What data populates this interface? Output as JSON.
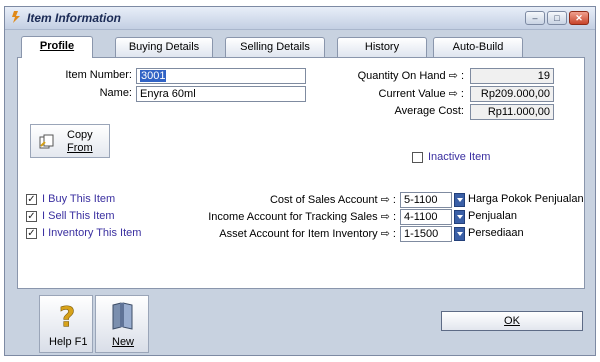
{
  "window": {
    "title": "Item Information",
    "buttons": [
      "minimize",
      "maximize",
      "close"
    ]
  },
  "tabs": [
    {
      "label": "Profile",
      "active": true
    },
    {
      "label": "Buying Details",
      "active": false
    },
    {
      "label": "Selling Details",
      "active": false
    },
    {
      "label": "History",
      "active": false
    },
    {
      "label": "Auto-Build",
      "active": false
    }
  ],
  "profile": {
    "item_number_label": "Item Number:",
    "item_number_value": "3001",
    "name_label": "Name:",
    "name_value": "Enyra 60ml",
    "qty_label": "Quantity On Hand ⇨ :",
    "qty_value": "19",
    "current_value_label": "Current Value ⇨ :",
    "current_value": "Rp209.000,00",
    "avg_cost_label": "Average Cost:",
    "avg_cost_value": "Rp11.000,00",
    "copy_from_label_1": "Copy",
    "copy_from_label_2": "From",
    "inactive_label": "Inactive Item"
  },
  "flags": [
    {
      "label": "I Buy This Item",
      "checked": true
    },
    {
      "label": "I Sell This Item",
      "checked": true
    },
    {
      "label": "I Inventory This Item",
      "checked": true
    }
  ],
  "accounts": [
    {
      "label": "Cost of Sales Account ⇨ :",
      "code": "5-1100",
      "name": "Harga Pokok Penjualan"
    },
    {
      "label": "Income Account for Tracking Sales ⇨ :",
      "code": "4-1100",
      "name": "Penjualan"
    },
    {
      "label": "Asset Account for Item Inventory ⇨ :",
      "code": "1-1500",
      "name": "Persediaan"
    }
  ],
  "bottom": {
    "help_label": "Help F1",
    "new_label": "New",
    "ok_label": "OK"
  },
  "colors": {
    "accent": "#3163c5",
    "checkbox_text": "#3a2fa0",
    "window_bg": "#c8d2e0"
  }
}
